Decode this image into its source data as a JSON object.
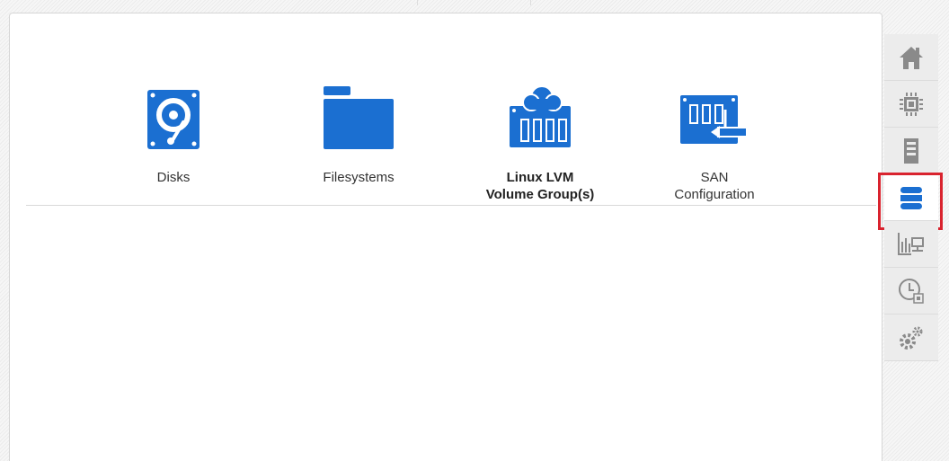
{
  "tiles": [
    {
      "label": "Disks",
      "icon": "hard-disk-icon"
    },
    {
      "label": "Filesystems",
      "icon": "folder-icon"
    },
    {
      "label": "Linux LVM\nVolume Group(s)",
      "icon": "lvm-volume-group-icon",
      "active": true
    },
    {
      "label": "SAN\nConfiguration",
      "icon": "san-configuration-icon"
    }
  ],
  "rail": [
    {
      "icon": "home-icon"
    },
    {
      "icon": "processor-icon"
    },
    {
      "icon": "server-icon"
    },
    {
      "icon": "storage-icon",
      "active": true
    },
    {
      "icon": "network-monitor-icon"
    },
    {
      "icon": "clock-schedule-icon"
    },
    {
      "icon": "settings-gears-icon"
    }
  ],
  "colors": {
    "accent": "#1b6fd1",
    "highlight": "#d9232e",
    "rail_icon": "#8a8a8a"
  }
}
